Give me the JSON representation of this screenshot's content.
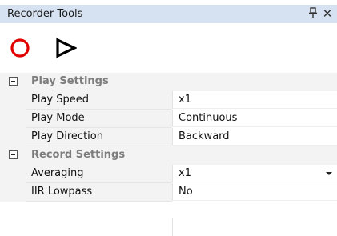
{
  "panel": {
    "title": "Recorder Tools",
    "pin_icon": "⨆",
    "close_icon": "✕"
  },
  "toolbar": {
    "record_icon": "record-circle-icon",
    "play_icon": "play-triangle-icon",
    "record_color": "#e00000",
    "play_color": "#000000"
  },
  "categories": [
    {
      "label": "Play Settings",
      "properties": [
        {
          "name": "Play Speed",
          "value": "x1"
        },
        {
          "name": "Play Mode",
          "value": "Continuous"
        },
        {
          "name": "Play Direction",
          "value": "Backward"
        }
      ]
    },
    {
      "label": "Record Settings",
      "properties": [
        {
          "name": "Averaging",
          "value": "x1",
          "dropdown": true
        },
        {
          "name": "IIR Lowpass",
          "value": "No"
        }
      ]
    }
  ]
}
